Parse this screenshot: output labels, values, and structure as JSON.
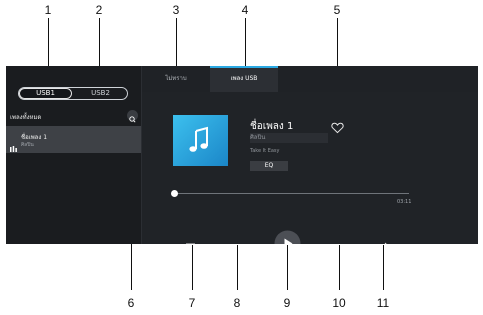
{
  "callouts": {
    "top": [
      "1",
      "2",
      "3",
      "4",
      "5"
    ],
    "bottom": [
      "6",
      "7",
      "8",
      "9",
      "10",
      "11"
    ]
  },
  "sidebar": {
    "usb_tabs": [
      "USB1",
      "USB2"
    ],
    "selected_usb": "USB1",
    "list_header": "เพลงทั้งหมด",
    "items": [
      {
        "title": "ชื่อเพลง 1",
        "artist": "ศิลปิน"
      }
    ]
  },
  "tabs": [
    {
      "label": "ไม่ทราบ",
      "active": false
    },
    {
      "label": "เพลง USB",
      "active": true
    }
  ],
  "now_playing": {
    "title": "ชื่อเพลง 1",
    "artist": "ศิลปิน",
    "album": "Take It Easy",
    "eq_label": "EQ",
    "favorite": false,
    "progress": 0,
    "total_time": "03:11"
  },
  "icons": {
    "album_art": "music-note-icon",
    "favorite": "heart-outline-icon",
    "sidebar_search": "search-icon",
    "playing_indicator": "equalizer-bars-icon",
    "controls": [
      "playlist-icon",
      "previous-icon",
      "play-icon",
      "next-icon",
      "repeat-icon"
    ]
  },
  "colors": {
    "accent": "#2aa9e3",
    "album_art": "#2ea6e0",
    "background": "#16181b"
  }
}
